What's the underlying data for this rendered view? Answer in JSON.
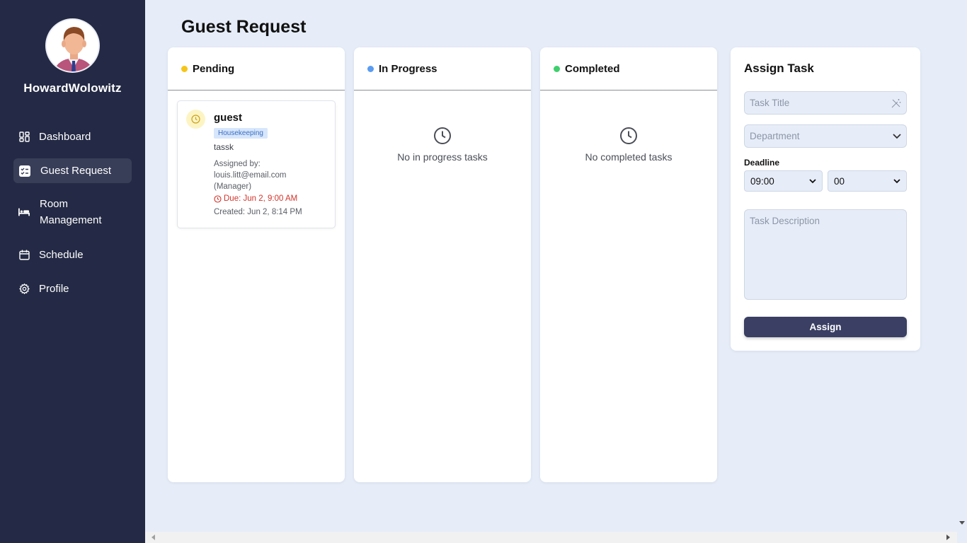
{
  "user": {
    "name": "HowardWolowitz",
    "avatar_icon": "man-avatar-icon"
  },
  "nav": [
    {
      "label": "Dashboard",
      "icon": "dashboard-icon",
      "active": false
    },
    {
      "label": "Guest Request",
      "icon": "checklist-icon",
      "active": true
    },
    {
      "label": "Room\nManagement",
      "icon": "bed-icon",
      "active": false
    },
    {
      "label": "Schedule",
      "icon": "calendar-icon",
      "active": false
    },
    {
      "label": "Profile",
      "icon": "gear-icon",
      "active": false
    }
  ],
  "page": {
    "title": "Guest Request"
  },
  "columns": {
    "pending": {
      "title": "Pending",
      "color": "#f5c518"
    },
    "in_progress": {
      "title": "In Progress",
      "color": "#5a9cf0",
      "empty": "No in progress tasks"
    },
    "completed": {
      "title": "Completed",
      "color": "#3fcf6e",
      "empty": "No completed tasks"
    }
  },
  "task": {
    "title": "guest",
    "department": "Housekeeping",
    "description": "tassk",
    "assigned_label": "Assigned by:",
    "assigned_email": "louis.litt@email.com",
    "assigned_role": "(Manager)",
    "due": "Due: Jun 2, 9:00 AM",
    "created": "Created: Jun 2, 8:14 PM"
  },
  "assign": {
    "title": "Assign Task",
    "task_title_placeholder": "Task Title",
    "department_placeholder": "Department",
    "deadline_label": "Deadline",
    "hour_value": "09:00",
    "minute_value": "00",
    "description_placeholder": "Task Description",
    "button_label": "Assign"
  }
}
